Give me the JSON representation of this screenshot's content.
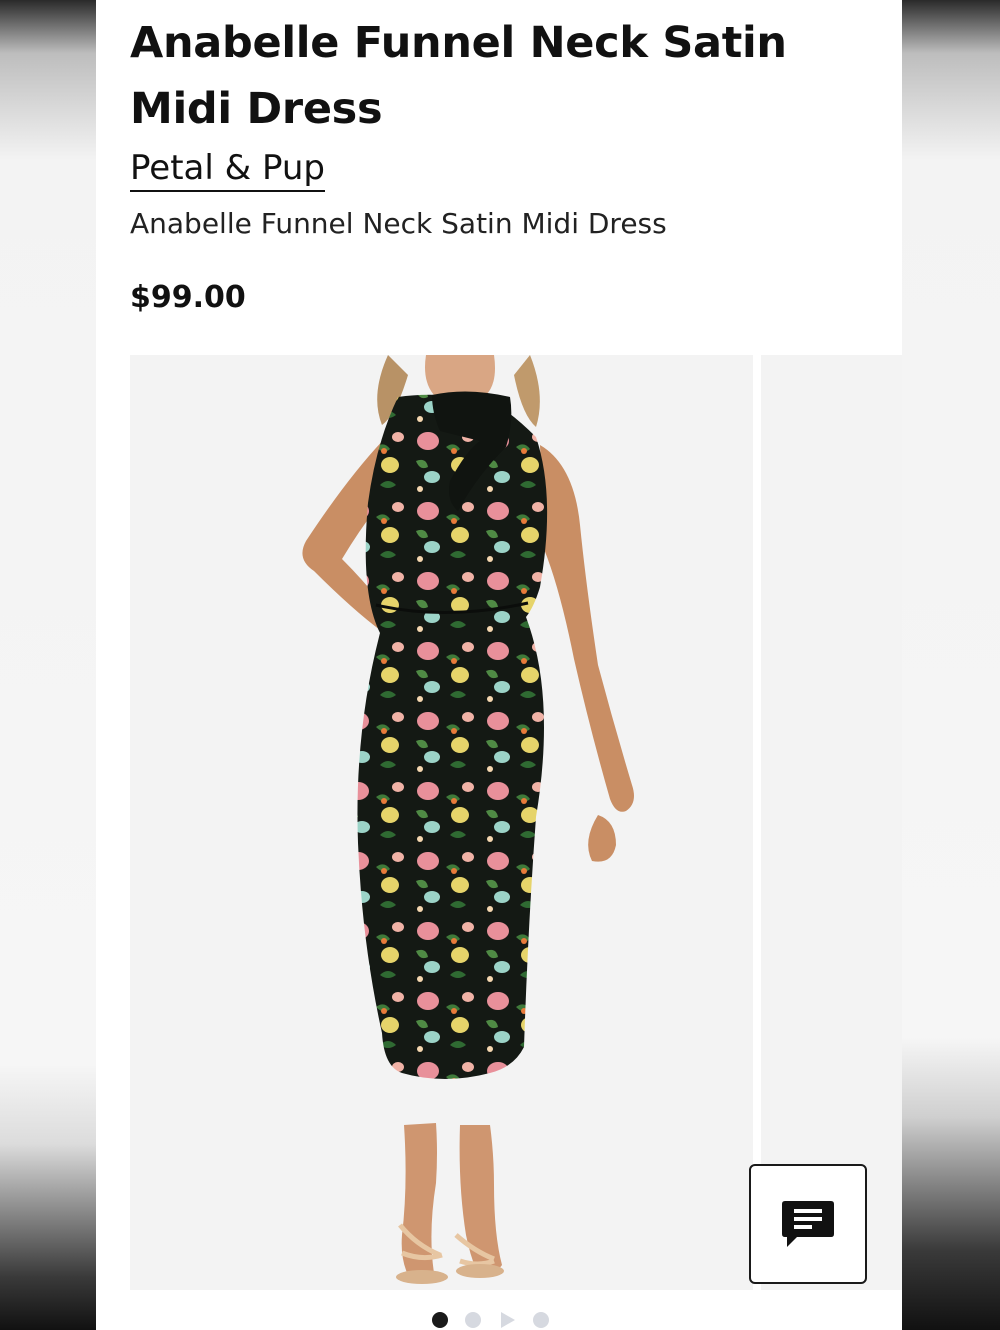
{
  "product": {
    "title": "Anabelle Funnel Neck Satin Midi Dress",
    "brand": "Petal & Pup",
    "subtitle": "Anabelle Funnel Neck Satin Midi Dress",
    "price": "$99.00"
  },
  "gallery": {
    "main_image": "model-wearing-black-floral-satin-halter-midi-dress",
    "slide_count": 4,
    "active_slide": 1,
    "dot_types": [
      "image",
      "image",
      "video",
      "image"
    ]
  },
  "chat": {
    "icon": "chat-bubble-icon"
  },
  "colors": {
    "text": "#111111",
    "background": "#ffffff",
    "image_background": "#f3f3f3",
    "dot_active": "#1a1a1a",
    "dot_inactive": "#d6d9e0"
  }
}
